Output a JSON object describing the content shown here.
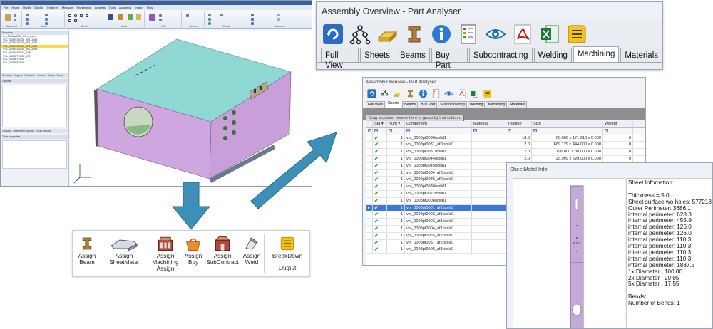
{
  "cad": {
    "menu": [
      "File",
      "Home",
      "Model",
      "Display",
      "Features",
      "Measure",
      "Sheetmetal",
      "Analysis",
      "Tools",
      "Assembly",
      "Import",
      "View"
    ],
    "ribbon_groups": [
      "Clipboard",
      "Orient",
      "Sketch",
      "Mode",
      "Edit",
      "Intersect",
      "Create",
      "Assembly"
    ],
    "tree_header": "Structure",
    "tree_items": [
      "vol_0008ss0002_0A+b_asm*",
      "VOL_0008SS0036_AF1_ASM",
      "VOL_0008SS0035_AF1_ASM",
      "VOL_0008SS0038_AF1_ASM",
      "VOL_0008SS0040_AF1_ASM",
      "VOL_0008SS0032_ASM",
      "VOL_0008PT0005_AF1",
      "VOL_0008PT0044",
      "VOL_0008PT0045"
    ],
    "panel_tabs": [
      "Structure",
      "Layers",
      "Selection",
      "Groups",
      "Views",
      "Tools"
    ],
    "options_label": "Options",
    "bottom_tabs": [
      "Options",
      "Intelmetrie options",
      "Tools options"
    ],
    "tools_properties": "Tools properties"
  },
  "assembly_overview": {
    "title": "Assembly Overview - Part Analyser",
    "tabs": [
      "Full View",
      "Sheets",
      "Beams",
      "Buy Part",
      "Subcontracting",
      "Welding",
      "Machining",
      "Materials"
    ],
    "active_tab": "Machining",
    "toolbar_icons": [
      "refresh-icon",
      "hierarchy-icon",
      "gold-bar-icon",
      "beam-icon",
      "info-icon",
      "list-icon",
      "eye-icon",
      "pdf-icon",
      "excel-icon",
      "report-icon"
    ]
  },
  "part_analyser": {
    "title": "Assembly Overview - Part Analyser",
    "tabs": [
      "Full View",
      "Sheets",
      "Beams",
      "Buy Part",
      "Subcontracting",
      "Welding",
      "Machining",
      "Materials"
    ],
    "active_tab": "Sheets",
    "group_hint": "Drag a column header here to group by that column.",
    "columns": [
      "Sta",
      "Num",
      "Component",
      "Material",
      "Thickne",
      "Size",
      "Weight"
    ],
    "rows": [
      {
        "num": "1",
        "component": "vol_0008pt0036/solid1",
        "thickness": "18.0",
        "size": "60.000 x 171.913 x 0.000",
        "weight": "0"
      },
      {
        "num": "1",
        "component": "vol_0008pt0031_af0/solid1",
        "thickness": "2.0",
        "size": "669.129 x 444.000 x 0.000",
        "weight": "0"
      },
      {
        "num": "1",
        "component": "vol_0008pt0037/solid1",
        "thickness": "2.0",
        "size": "196.000 x 80.000 x 0.000",
        "weight": "0"
      },
      {
        "num": "1",
        "component": "vol_0008pt0044/solid1",
        "thickness": "2.0",
        "size": "25.999 x 620.000 x 0.000",
        "weight": "0"
      },
      {
        "num": "1",
        "component": "vol_0008pt0045/solid1",
        "thickness": "",
        "size": "",
        "weight": ""
      },
      {
        "num": "1",
        "component": "vol_0008pt0034_af0/solid1",
        "thickness": "",
        "size": "",
        "weight": ""
      },
      {
        "num": "1",
        "component": "vol_0008pt0035_af0/solid1",
        "thickness": "",
        "size": "",
        "weight": ""
      },
      {
        "num": "1",
        "component": "vol_0008pt0030/solid1",
        "thickness": "",
        "size": "",
        "weight": ""
      },
      {
        "num": "1",
        "component": "vol_0008pt0022/solid1",
        "thickness": "",
        "size": "",
        "weight": ""
      },
      {
        "num": "1",
        "component": "vol_0008pt0008/solid1",
        "thickness": "",
        "size": "",
        "weight": ""
      },
      {
        "num": "1",
        "component": "vol_0008pt0001_af1/solid1",
        "thickness": "",
        "size": "",
        "weight": "",
        "selected": true
      },
      {
        "num": "1",
        "component": "vol_0008pt0002_af1/solid1",
        "thickness": "",
        "size": "",
        "weight": ""
      },
      {
        "num": "1",
        "component": "vol_0008pt0003_af1/solid1",
        "thickness": "",
        "size": "",
        "weight": ""
      },
      {
        "num": "1",
        "component": "vol_0008pt0004_af1/solid1",
        "thickness": "",
        "size": "",
        "weight": ""
      },
      {
        "num": "1",
        "component": "vol_0008pt0055_af2/solid1",
        "thickness": "",
        "size": "",
        "weight": ""
      },
      {
        "num": "1",
        "component": "vol_0008pt0057_af2/solid1",
        "thickness": "",
        "size": "",
        "weight": ""
      },
      {
        "num": "1",
        "component": "vol_0008pt0005_af1/solid1",
        "thickness": "",
        "size": "",
        "weight": ""
      }
    ]
  },
  "sheetmetal": {
    "title": "SheetMetal Info",
    "lines": [
      "Sheet Infomation:",
      "",
      "Thickness = 5.0",
      "Sheet surface wo holes: 577218.6",
      "Outer Perimeter: 3686.1",
      "internal perimeter: 628.3",
      "internal perimeter: 455.9",
      "internal perimeter: 126.0",
      "internal perimeter: 126.0",
      "internal perimeter: 110.3",
      "internal perimeter: 110.3",
      "internal perimeter: 110.3",
      "internal perimeter: 110.3",
      "internal perimeter: 1887.5",
      "1x Diameter : 100.00",
      "2x Diameter : 20.05",
      "5x Diameter : 17.55",
      "",
      "Bends:",
      "Number of Bends: 1"
    ]
  },
  "assign": {
    "beam": "Assign Beam",
    "sheetmetal": "Assign SheetMetal",
    "machining": "Assign Machining Assign",
    "buy": "Assign Buy",
    "subcontract": "Assign SubContract",
    "weld": "Assign Weld",
    "breakdown": "BreakDown",
    "output": "Output"
  },
  "colors": {
    "arrow": "#3e8fb8",
    "box_purple": "#c79fd8",
    "box_top": "#8fd6d4",
    "selection": "#3c78d8"
  }
}
